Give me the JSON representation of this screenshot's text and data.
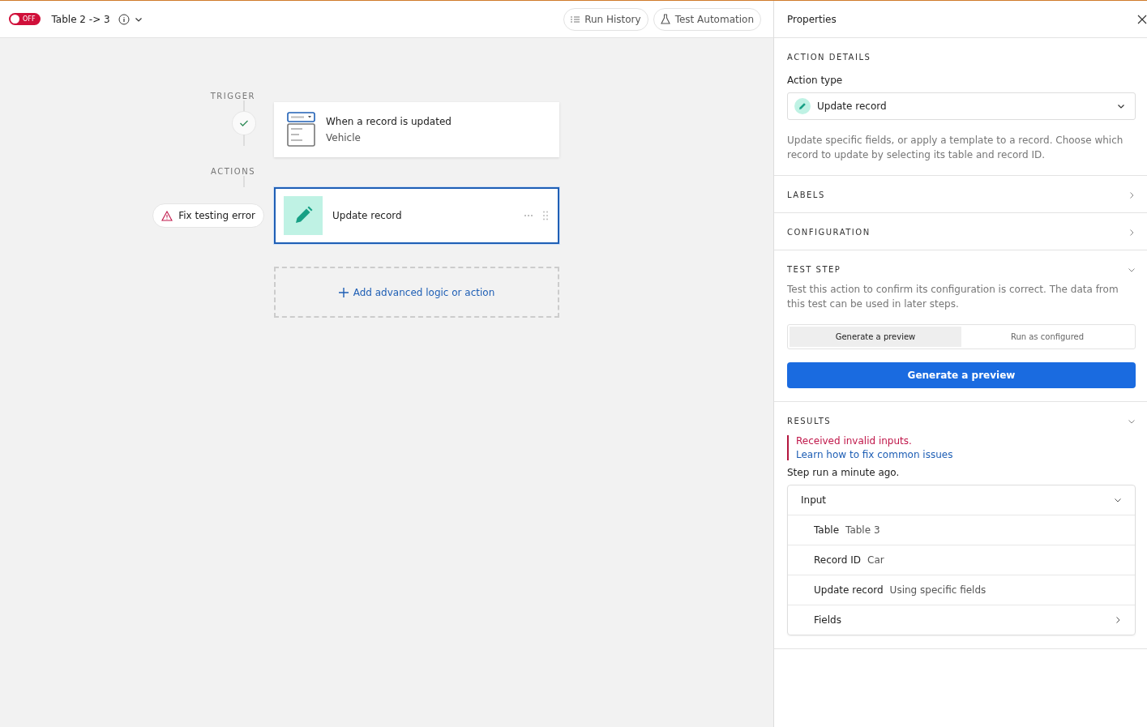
{
  "toolbar": {
    "toggle": {
      "on": false,
      "label": "OFF"
    },
    "title": "Table 2 -> 3",
    "buttons": [
      {
        "kind": "history",
        "label": "Run History"
      },
      {
        "kind": "test",
        "label": "Test Automation"
      }
    ]
  },
  "flow": {
    "trigger_label": "TRIGGER",
    "trigger_done": true,
    "trigger": {
      "title": "When a record is updated",
      "subtitle": "Vehicle"
    },
    "actions_label": "ACTIONS",
    "error_badge": "Fix testing error",
    "actions": [
      {
        "title": "Update record",
        "selected": true
      }
    ],
    "add_button": "Add advanced logic or action"
  },
  "properties": {
    "title": "Properties",
    "sections": [
      {
        "kind": "details",
        "title": "ACTION DETAILS",
        "field_label": "Action type",
        "field_value": "Update record",
        "description": "Update specific fields, or apply a template to a record. Choose which record to update by selecting its table and record ID."
      },
      {
        "kind": "plain",
        "title": "LABELS",
        "expanded": false
      },
      {
        "kind": "plain",
        "title": "CONFIGURATION",
        "expanded": false
      },
      {
        "kind": "test",
        "title": "TEST STEP",
        "expanded": true,
        "description": "Test this action to confirm its configuration is correct. The data from this test can be used in later steps.",
        "modes": [
          {
            "label": "Generate a preview",
            "selected": true
          },
          {
            "label": "Run as configured",
            "selected": false
          }
        ],
        "button": "Generate a preview"
      },
      {
        "kind": "results",
        "title": "RESULTS",
        "expanded": true,
        "error": "Received invalid inputs.",
        "link": "Learn how to fix common issues",
        "status": "Step run a minute ago.",
        "input": {
          "title": "Input",
          "expanded": true,
          "rows": [
            {
              "kind": "pair",
              "label": "Table",
              "value": "Table 3"
            },
            {
              "kind": "pair",
              "label": "Record ID",
              "value": "Car"
            },
            {
              "kind": "pair",
              "label": "Update record",
              "value": "Using specific fields"
            },
            {
              "kind": "nav",
              "label": "Fields"
            }
          ]
        }
      }
    ]
  }
}
